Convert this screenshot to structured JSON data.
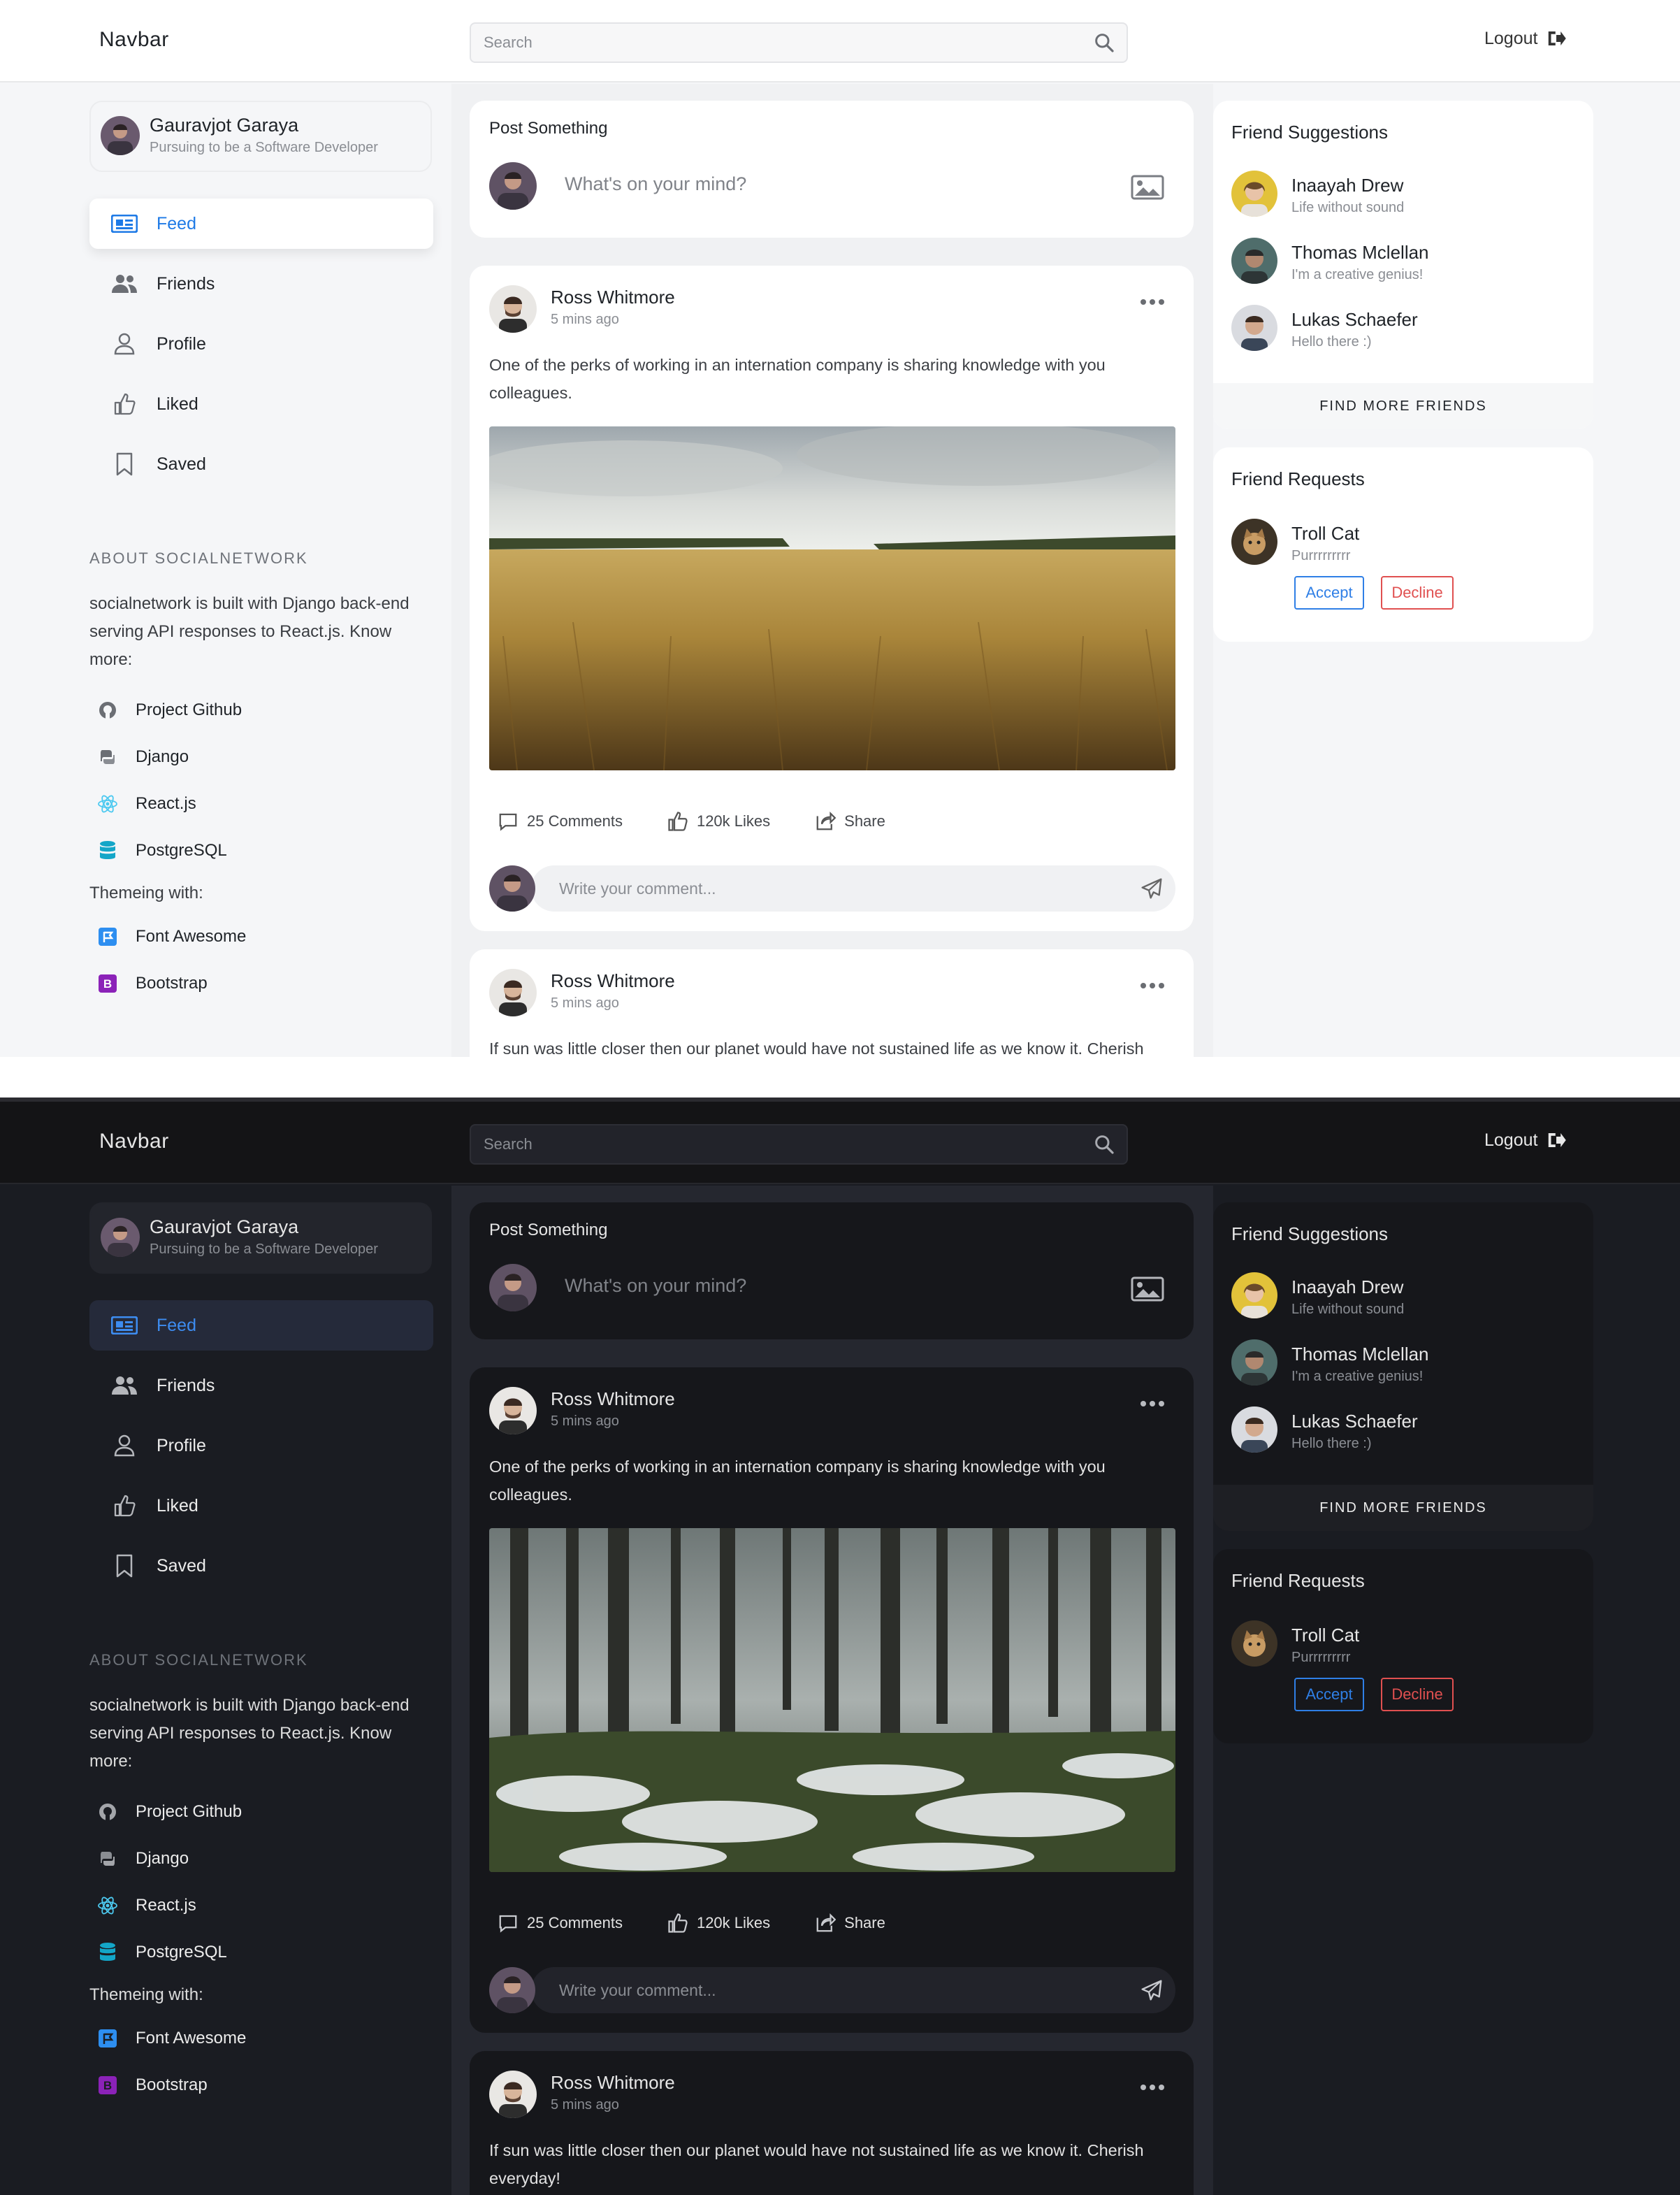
{
  "colors": {
    "accent": "#1e7ae6",
    "accept": "#2f7fe6",
    "decline": "#e05050"
  },
  "navbar": {
    "brand": "Navbar",
    "search_placeholder": "Search",
    "logout": "Logout"
  },
  "user": {
    "name": "Gauravjot Garaya",
    "tagline": "Pursuing to be a Software Developer"
  },
  "nav_items": [
    {
      "label": "Feed",
      "icon": "newspaper-icon"
    },
    {
      "label": "Friends",
      "icon": "users-icon"
    },
    {
      "label": "Profile",
      "icon": "user-icon"
    },
    {
      "label": "Liked",
      "icon": "thumbs-up-icon"
    },
    {
      "label": "Saved",
      "icon": "bookmark-icon"
    }
  ],
  "about": {
    "title": "ABOUT SOCIALNETWORK",
    "text": "socialnetwork is built with Django back-end serving API responses to React.js. Know more:",
    "links": [
      {
        "label": "Project Github",
        "icon": "github-icon"
      },
      {
        "label": "Django",
        "icon": "python-icon"
      },
      {
        "label": "React.js",
        "icon": "react-icon"
      },
      {
        "label": "PostgreSQL",
        "icon": "database-icon"
      }
    ],
    "theme_title": "Themeing with:",
    "theme_links": [
      {
        "label": "Font Awesome",
        "icon": "font-awesome-icon"
      },
      {
        "label": "Bootstrap",
        "icon": "bootstrap-icon"
      }
    ]
  },
  "post_box": {
    "title": "Post Something",
    "placeholder": "What's on your mind?"
  },
  "posts": [
    {
      "author": "Ross Whitmore",
      "time": "5 mins ago",
      "text": "One of the perks of working in an internation company is sharing knowledge with you colleagues.",
      "comments": "25 Comments",
      "likes": "120k Likes",
      "share": "Share",
      "comment_placeholder": "Write your comment..."
    },
    {
      "author": "Ross Whitmore",
      "time": "5 mins ago",
      "text_light": "If sun was little closer then our planet would have not sustained life as we know it. Cherish",
      "text_dark": "If sun was little closer then our planet would have not sustained life as we know it. Cherish everyday!"
    }
  ],
  "suggestions": {
    "title": "Friend Suggestions",
    "items": [
      {
        "name": "Inaayah Drew",
        "desc": "Life without sound"
      },
      {
        "name": "Thomas Mclellan",
        "desc": "I'm a creative genius!"
      },
      {
        "name": "Lukas Schaefer",
        "desc": "Hello there :)"
      }
    ],
    "find_more": "FIND MORE FRIENDS"
  },
  "requests": {
    "title": "Friend Requests",
    "items": [
      {
        "name": "Troll Cat",
        "desc": "Purrrrrrrrr",
        "accept": "Accept",
        "decline": "Decline"
      }
    ]
  }
}
